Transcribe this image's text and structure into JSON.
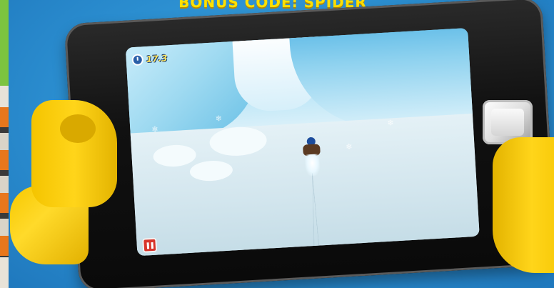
{
  "page": {
    "banner_title": "BONUS CODE: SPIDER"
  },
  "game": {
    "hud": {
      "timer_icon": "stopwatch-icon",
      "timer_value": "17.3",
      "pause_icon": "pause-icon"
    }
  },
  "colors": {
    "background": "#2b8ed0",
    "banner_text": "#ffe100",
    "lego_yellow": "#ffd51a",
    "pause_red": "#d8342a",
    "timer_text": "#ffe35c"
  }
}
